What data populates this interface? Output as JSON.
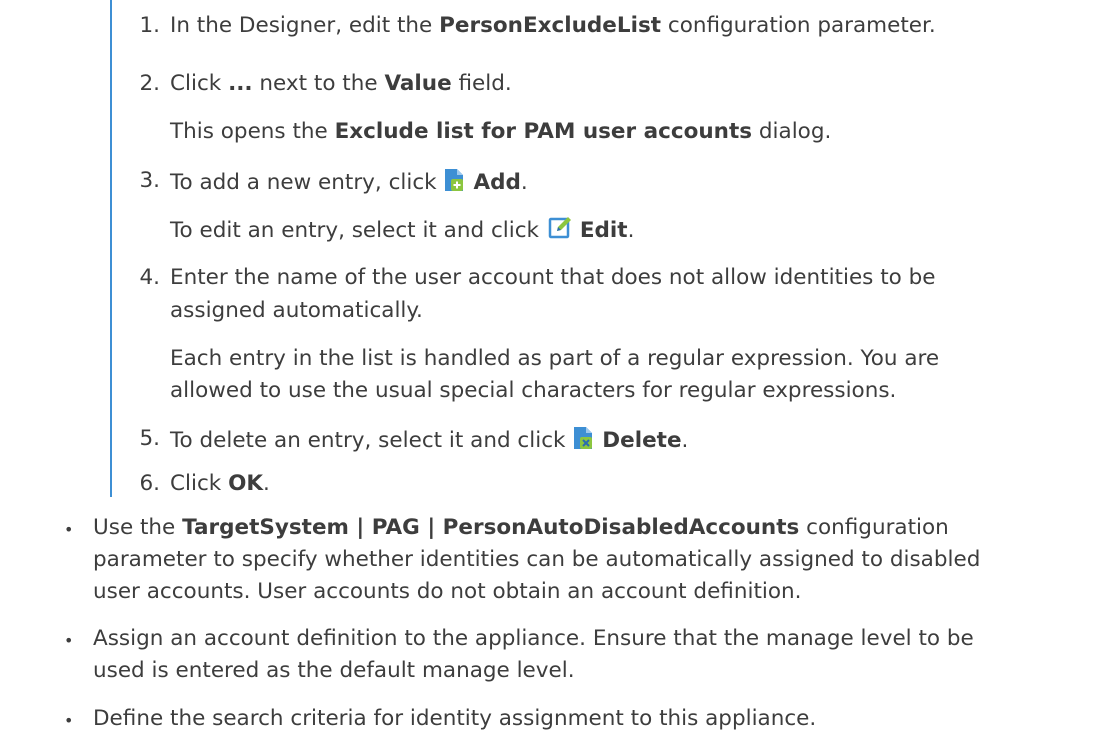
{
  "steps": [
    {
      "num": "1.",
      "pre": "In the Designer, edit the ",
      "bold": "PersonExcludeList",
      "post": " configuration parameter."
    },
    {
      "num": "2.",
      "pre": "Click ",
      "bold1": "...",
      "mid": " next to the ",
      "bold2": "Value",
      "post": " field.",
      "sub_pre": "This opens the ",
      "sub_bold": "Exclude list for PAM user accounts",
      "sub_post": " dialog."
    },
    {
      "num": "3.",
      "pre": "To add a new entry, click ",
      "icon": "add-document-icon",
      "bold": "Add",
      "post": ".",
      "sub_pre": "To edit an entry, select it and click ",
      "sub_icon": "edit-icon",
      "sub_bold": "Edit",
      "sub_post": "."
    },
    {
      "num": "4.",
      "line1": "Enter the name of the user account that does not allow identities to be",
      "line2": "assigned automatically.",
      "sub1": "Each entry in the list is handled as part of a regular expression. You are",
      "sub2": "allowed to use the usual special characters for regular expressions."
    },
    {
      "num": "5.",
      "pre": "To delete an entry, select it and click ",
      "icon": "delete-document-icon",
      "bold": "Delete",
      "post": "."
    },
    {
      "num": "6.",
      "pre": "Click ",
      "bold": "OK",
      "post": "."
    }
  ],
  "bullets": [
    {
      "pre": "Use the ",
      "bold": "TargetSystem | PAG | PersonAutoDisabledAccounts",
      "post": " configuration",
      "line2": "parameter to specify whether identities can be automatically assigned to disabled",
      "line3": "user accounts. User accounts do not obtain an account definition."
    },
    {
      "line1": "Assign an account definition to the appliance. Ensure that the manage level to be",
      "line2": "used is entered as the default manage level."
    },
    {
      "line1": "Define the search criteria for identity assignment to this appliance."
    }
  ],
  "bullet_char": "•",
  "colors": {
    "text": "#3d3d3d",
    "bar": "#3d8fd4",
    "add_icon": "#3d8fd4",
    "plus": "#8cc63f",
    "delete_x": "#2b6cb0"
  }
}
